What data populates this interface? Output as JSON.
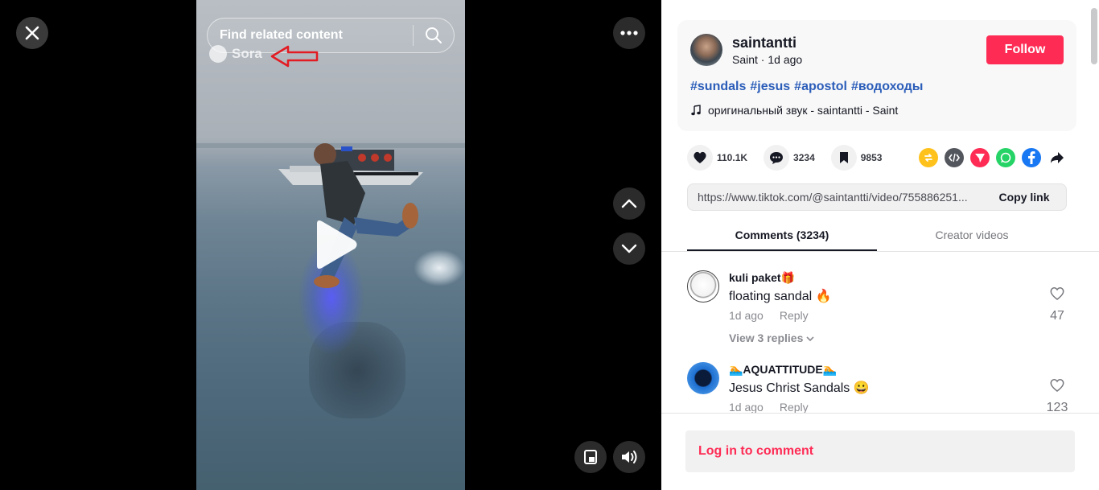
{
  "video": {
    "search_placeholder": "Find related content",
    "watermark": "Sora",
    "icons": {
      "close": "close-icon",
      "more": "ellipsis-icon",
      "search": "search-icon",
      "play": "play-icon",
      "up": "chevron-up-icon",
      "down": "chevron-down-icon",
      "pip": "picture-in-picture-icon",
      "volume": "volume-icon"
    }
  },
  "author": {
    "username": "saintantti",
    "subtitle": "Saint · 1d ago",
    "follow_label": "Follow",
    "hashtags": [
      "#sundals",
      "#jesus",
      "#apostol",
      "#водоходы"
    ],
    "sound": "оригинальный звук - saintantti - Saint"
  },
  "stats": {
    "likes": "110.1K",
    "comments": "3234",
    "saves": "9853"
  },
  "share": {
    "url": "https://www.tiktok.com/@saintantti/video/755886251...",
    "copy_label": "Copy link",
    "icons": [
      "repost-icon",
      "embed-icon",
      "send-icon",
      "whatsapp-icon",
      "facebook-icon",
      "share-arrow-icon"
    ]
  },
  "tabs": {
    "comments": "Comments (3234)",
    "creator": "Creator videos"
  },
  "comments": [
    {
      "name": "kuli paket🎁",
      "text": "floating sandal 🔥",
      "time": "1d ago",
      "reply": "Reply",
      "replies": "View 3 replies",
      "likes": "47"
    },
    {
      "name": "🏊AQUATTITUDE🏊",
      "text": "Jesus Christ Sandals 😀",
      "time": "1d ago",
      "reply": "Reply",
      "likes": "123"
    }
  ],
  "login_label": "Log in to comment",
  "colors": {
    "accent": "#fe2c55",
    "hashtag": "#2b5db9"
  }
}
